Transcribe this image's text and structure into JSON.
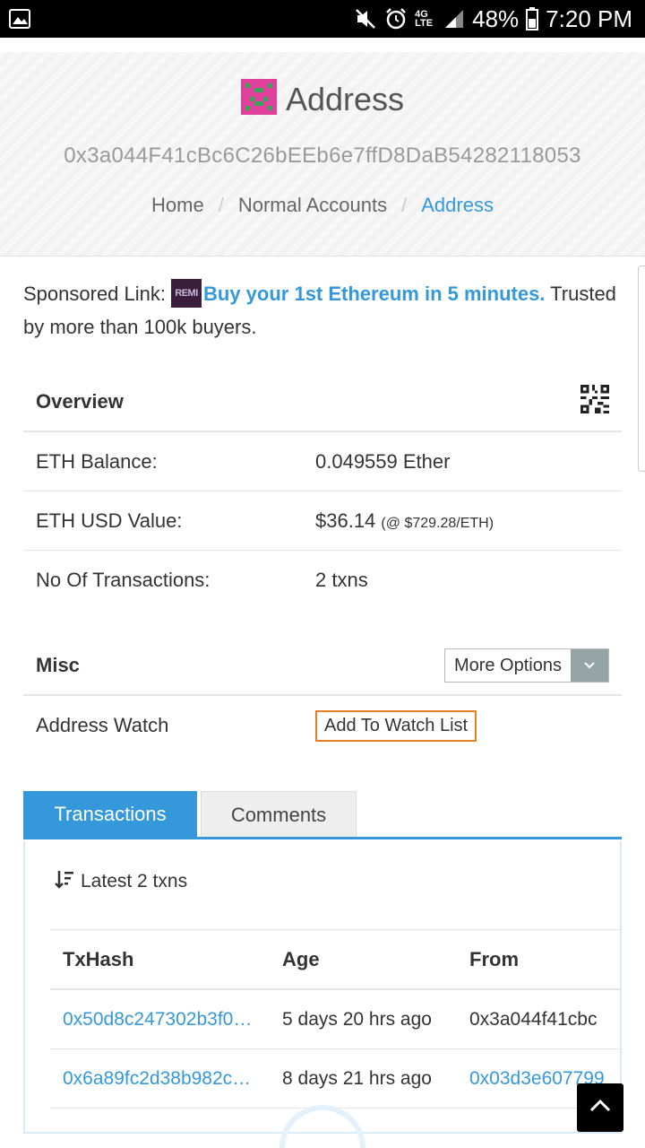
{
  "status_bar": {
    "battery": "48%",
    "time": "7:20 PM",
    "network": "4G LTE"
  },
  "header": {
    "title": "Address",
    "address": "0x3a044F41cBc6C26bEEb6e7ffD8DaB54282118053",
    "breadcrumb": [
      "Home",
      "Normal Accounts",
      "Address"
    ]
  },
  "sponsored": {
    "label": "Sponsored Link:",
    "logo_text": "REMI",
    "link_text": "Buy your 1st Ethereum in 5 minutes.",
    "rest_text": " Trusted by more than 100k buyers."
  },
  "overview": {
    "heading": "Overview",
    "rows": [
      {
        "label": "ETH Balance:",
        "value": "0.049559 Ether",
        "note": ""
      },
      {
        "label": "ETH USD Value:",
        "value": "$36.14",
        "note": "(@ $729.28/ETH)"
      },
      {
        "label": "No Of Transactions:",
        "value": "2 txns",
        "note": ""
      }
    ]
  },
  "misc": {
    "heading": "Misc",
    "more_options": "More Options",
    "watch_label": "Address Watch",
    "watch_button": "Add To Watch List"
  },
  "tabs": [
    "Transactions",
    "Comments"
  ],
  "transactions": {
    "latest": "Latest 2 txns",
    "columns": [
      "TxHash",
      "Age",
      "From"
    ],
    "rows": [
      {
        "hash": "0x50d8c247302b3f0…",
        "age": "5 days 20 hrs ago",
        "from": "0x3a044f41cbc"
      },
      {
        "hash": "0x6a89fc2d38b982c…",
        "age": "8 days 21 hrs ago",
        "from": "0x03d3e607799"
      }
    ]
  },
  "colors": {
    "accent": "#3498db",
    "watch_border": "#e67e22",
    "identicon": "#e0409a"
  }
}
